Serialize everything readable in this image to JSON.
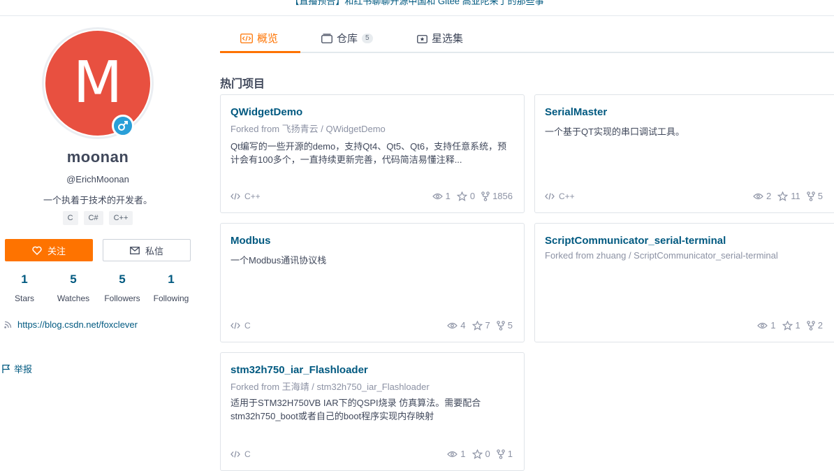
{
  "banner": {
    "text": "【直播预告】和红书聊聊开源中国和 Gitee 高亚陀来了的那些事"
  },
  "profile": {
    "avatar_letter": "M",
    "name": "moonan",
    "handle": "@ErichMoonan",
    "bio": "一个执着于技术的开发者。",
    "languages": [
      "C",
      "C#",
      "C++"
    ],
    "follow_label": "关注",
    "message_label": "私信",
    "stats": [
      {
        "num": "1",
        "label": "Stars"
      },
      {
        "num": "5",
        "label": "Watches"
      },
      {
        "num": "5",
        "label": "Followers"
      },
      {
        "num": "1",
        "label": "Following"
      }
    ],
    "blog": "https://blog.csdn.net/foxclever",
    "report_label": "举报"
  },
  "tabs": [
    {
      "label": "概览",
      "icon": "code-icon",
      "active": true
    },
    {
      "label": "仓库",
      "icon": "repo-icon",
      "count": "5"
    },
    {
      "label": "星选集",
      "icon": "star-box-icon"
    }
  ],
  "section_title": "热门项目",
  "projects": [
    {
      "title": "QWidgetDemo",
      "fork": "Forked from 飞扬青云  / QWidgetDemo",
      "desc": "Qt编写的一些开源的demo，支持Qt4、Qt5、Qt6，支持任意系统，预计会有100多个，一直持续更新完善，代码简洁易懂注释...",
      "lang": "C++",
      "watch": "1",
      "star": "0",
      "fork_count": "1856"
    },
    {
      "title": "SerialMaster",
      "fork": "",
      "desc": "一个基于QT实现的串口调试工具。",
      "lang": "C++",
      "watch": "2",
      "star": "11",
      "fork_count": "5"
    },
    {
      "title": "Modbus",
      "fork": "",
      "desc": "一个Modbus通讯协议栈",
      "lang": "C",
      "watch": "4",
      "star": "7",
      "fork_count": "5"
    },
    {
      "title": "ScriptCommunicator_serial-terminal",
      "fork": "Forked from zhuang  / ScriptCommunicator_serial-terminal",
      "desc": "",
      "lang": "",
      "watch": "1",
      "star": "1",
      "fork_count": "2"
    },
    {
      "title": "stm32h750_iar_Flashloader",
      "fork": "Forked from 王海靖  / stm32h750_iar_Flashloader",
      "desc": "适用于STM32H750VB IAR下的QSPI烧录 仿真算法。需要配合stm32h750_boot或者自己的boot程序实现内存映射",
      "lang": "C",
      "watch": "1",
      "star": "0",
      "fork_count": "1"
    }
  ]
}
